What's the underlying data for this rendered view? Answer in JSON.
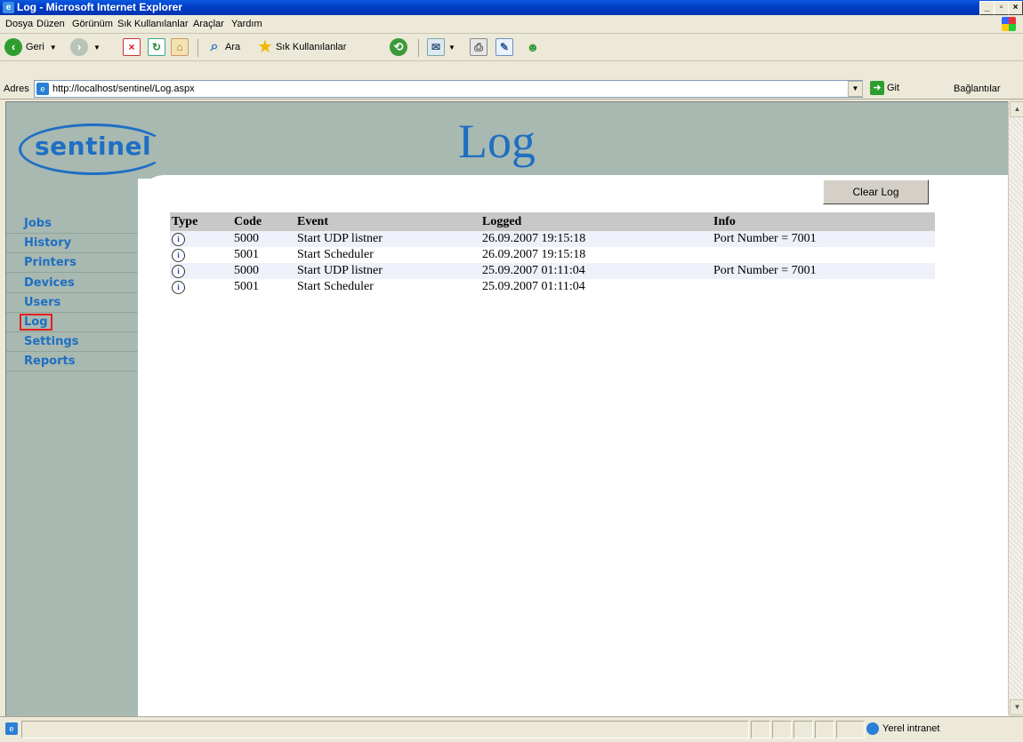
{
  "window": {
    "title": "Log - Microsoft Internet Explorer",
    "buttons": {
      "minimize": "_",
      "maximize": "▫",
      "close": "×"
    }
  },
  "menu": [
    "Dosya",
    "Düzen",
    "Görünüm",
    "Sık Kullanılanlar",
    "Araçlar",
    "Yardım"
  ],
  "toolbar": {
    "back_label": "Geri",
    "search_label": "Ara",
    "favorites_label": "Sık Kullanılanlar"
  },
  "address": {
    "label": "Adres",
    "url": "http://localhost/sentinel/Log.aspx",
    "go_label": "Git",
    "links_label": "Bağlantılar"
  },
  "page": {
    "logo_text": "sentinel",
    "title": "Log",
    "clear_button": "Clear Log"
  },
  "nav": [
    "Jobs",
    "History",
    "Printers",
    "Devices",
    "Users",
    "Log",
    "Settings",
    "Reports"
  ],
  "nav_active": "Log",
  "table": {
    "columns": [
      "Type",
      "Code",
      "Event",
      "Logged",
      "Info"
    ],
    "rows": [
      {
        "type": "info-icon",
        "code": "5000",
        "event": "Start UDP listner",
        "logged": "26.09.2007 19:15:18",
        "info": "Port Number = 7001"
      },
      {
        "type": "info-icon",
        "code": "5001",
        "event": "Start Scheduler",
        "logged": "26.09.2007 19:15:18",
        "info": ""
      },
      {
        "type": "info-icon",
        "code": "5000",
        "event": "Start UDP listner",
        "logged": "25.09.2007 01:11:04",
        "info": "Port Number = 7001"
      },
      {
        "type": "info-icon",
        "code": "5001",
        "event": "Start Scheduler",
        "logged": "25.09.2007 01:11:04",
        "info": ""
      }
    ]
  },
  "status": {
    "zone": "Yerel intranet"
  },
  "colors": {
    "header_bg": "#a8b9b1",
    "accent_blue": "#1f6fc2",
    "active_outline": "#e02020"
  }
}
